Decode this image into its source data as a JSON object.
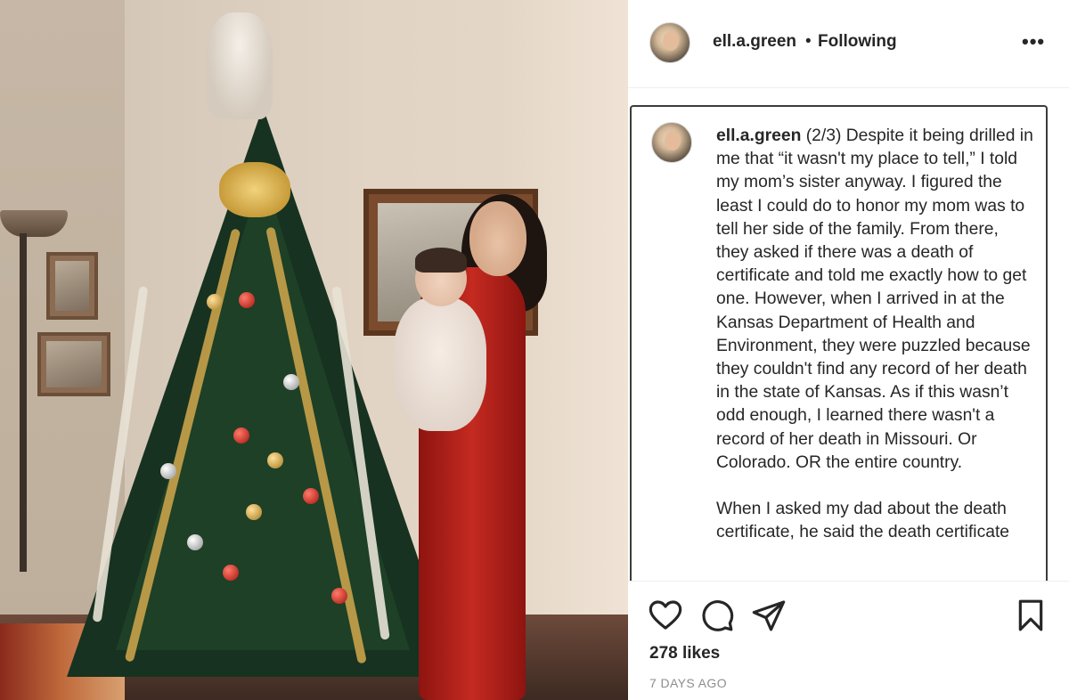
{
  "post": {
    "username": "ell.a.green",
    "separator": "•",
    "follow_status": "Following",
    "more_icon": "more-horizontal-icon",
    "caption": {
      "username": "ell.a.green",
      "text": " (2/3) Despite it being drilled in me that “it wasn't my place to tell,” I told my mom’s sister anyway. I figured the least I could do to honor my mom was to tell her side of the family. From there, they asked if there was a death of certificate and told me exactly how to get one. However, when I arrived in at the Kansas Department of Health and Environment, they were puzzled because they couldn't find any record of her death in the state of Kansas. As if this wasn’t odd enough, I learned there wasn't a record of her death in Missouri. Or Colorado. OR the entire country.\n\nWhen I asked my dad about the death certificate, he said the death certificate"
    },
    "likes": "278 likes",
    "timestamp": "7 DAYS AGO",
    "actions": [
      "heart-icon",
      "comment-icon",
      "share-icon",
      "bookmark-icon"
    ]
  }
}
